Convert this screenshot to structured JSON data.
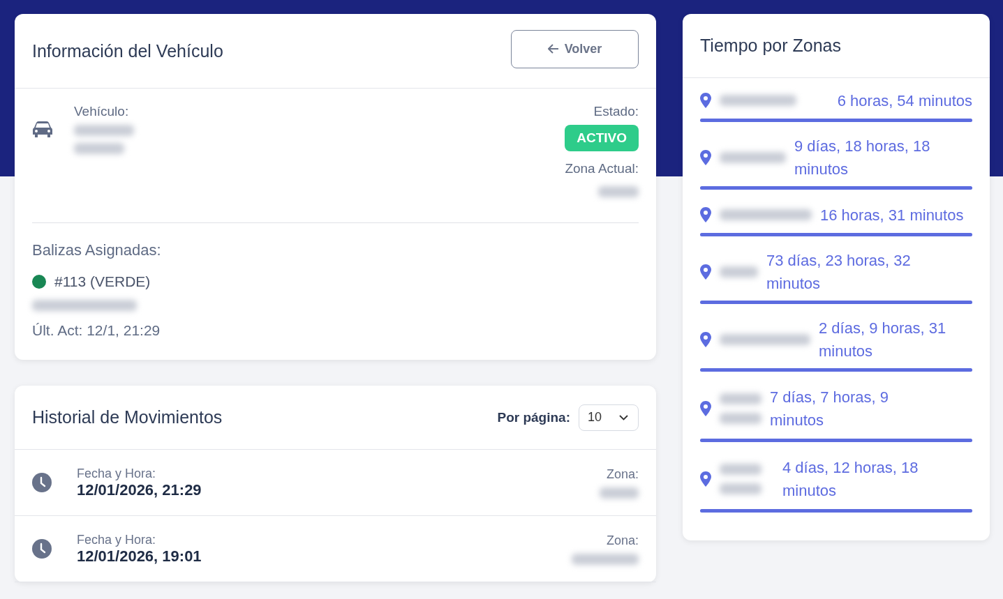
{
  "vehicle_card": {
    "title": "Información del Vehículo",
    "back_button": "Volver",
    "vehicle_label": "Vehículo:",
    "status_label": "Estado:",
    "status": "ACTIVO",
    "zone_label": "Zona Actual:",
    "beacons_title": "Balizas Asignadas:",
    "beacons": [
      {
        "name": "#113 (VERDE)",
        "color": "#198754",
        "updated": "Últ. Act: 12/1, 21:29"
      }
    ]
  },
  "history_card": {
    "title": "Historial de Movimientos",
    "per_page_label": "Por página:",
    "per_page_value": "10",
    "rows": [
      {
        "date_label": "Fecha y Hora:",
        "date": "12/01/2026, 21:29",
        "zone_label": "Zona:"
      },
      {
        "date_label": "Fecha y Hora:",
        "date": "12/01/2026, 19:01",
        "zone_label": "Zona:"
      }
    ]
  },
  "zones_card": {
    "title": "Tiempo por Zonas",
    "zones": [
      {
        "time": "6 horas, 54 minutos",
        "level": 1
      },
      {
        "time": "9 días, 18 horas, 18 minutos",
        "level": 1
      },
      {
        "time": "16 horas, 31 minutos",
        "level": 1
      },
      {
        "time": "73 días, 23 horas, 32 minutos",
        "level": 1
      },
      {
        "time": "2 días, 9 horas, 31 minutos",
        "level": 1
      },
      {
        "time": "7 días, 7 horas, 9 minutos",
        "level": 1
      },
      {
        "time": "4 días, 12 horas, 18 minutos",
        "level": 1
      }
    ]
  }
}
